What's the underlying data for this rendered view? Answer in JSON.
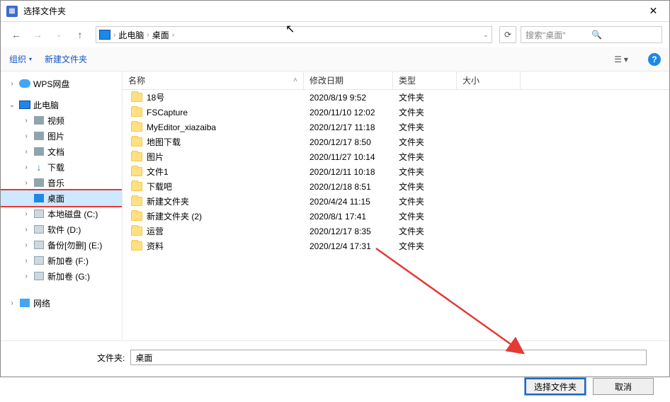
{
  "window": {
    "title": "选择文件夹"
  },
  "nav": {
    "crumbs": [
      "此电脑",
      "桌面"
    ],
    "search_placeholder": "搜索\"桌面\""
  },
  "toolbar": {
    "organize": "组织",
    "new_folder": "新建文件夹"
  },
  "columns": {
    "name": "名称",
    "date": "修改日期",
    "type": "类型",
    "size": "大小"
  },
  "sidebar": [
    {
      "label": "WPS网盘",
      "indent": 10,
      "exp": "›",
      "icon": "cloud"
    },
    {
      "label": "此电脑",
      "indent": 10,
      "exp": "⌄",
      "icon": "pc"
    },
    {
      "label": "视频",
      "indent": 30,
      "exp": "›",
      "icon": "generic"
    },
    {
      "label": "图片",
      "indent": 30,
      "exp": "›",
      "icon": "generic"
    },
    {
      "label": "文档",
      "indent": 30,
      "exp": "›",
      "icon": "generic"
    },
    {
      "label": "下载",
      "indent": 30,
      "exp": "›",
      "icon": "down"
    },
    {
      "label": "音乐",
      "indent": 30,
      "exp": "›",
      "icon": "generic"
    },
    {
      "label": "桌面",
      "indent": 30,
      "exp": "",
      "icon": "desk",
      "sel": true,
      "redbox": true
    },
    {
      "label": "本地磁盘 (C:)",
      "indent": 30,
      "exp": "›",
      "icon": "disk"
    },
    {
      "label": "软件 (D:)",
      "indent": 30,
      "exp": "›",
      "icon": "disk"
    },
    {
      "label": "备份[勿删] (E:)",
      "indent": 30,
      "exp": "›",
      "icon": "disk"
    },
    {
      "label": "新加卷 (F:)",
      "indent": 30,
      "exp": "›",
      "icon": "disk"
    },
    {
      "label": "新加卷 (G:)",
      "indent": 30,
      "exp": "›",
      "icon": "disk"
    },
    {
      "label": "网络",
      "indent": 10,
      "exp": "›",
      "icon": "net"
    }
  ],
  "files": [
    {
      "name": "18号",
      "date": "2020/8/19 9:52",
      "type": "文件夹"
    },
    {
      "name": "FSCapture",
      "date": "2020/11/10 12:02",
      "type": "文件夹"
    },
    {
      "name": "MyEditor_xiazaiba",
      "date": "2020/12/17 11:18",
      "type": "文件夹"
    },
    {
      "name": "地图下载",
      "date": "2020/12/17 8:50",
      "type": "文件夹"
    },
    {
      "name": "图片",
      "date": "2020/11/27 10:14",
      "type": "文件夹"
    },
    {
      "name": "文件1",
      "date": "2020/12/11 10:18",
      "type": "文件夹"
    },
    {
      "name": "下载吧",
      "date": "2020/12/18 8:51",
      "type": "文件夹"
    },
    {
      "name": "新建文件夹",
      "date": "2020/4/24 11:15",
      "type": "文件夹"
    },
    {
      "name": "新建文件夹 (2)",
      "date": "2020/8/1 17:41",
      "type": "文件夹"
    },
    {
      "name": "运营",
      "date": "2020/12/17 8:35",
      "type": "文件夹"
    },
    {
      "name": "资料",
      "date": "2020/12/4 17:31",
      "type": "文件夹"
    }
  ],
  "bottom": {
    "label": "文件夹:",
    "value": "桌面",
    "ok": "选择文件夹",
    "cancel": "取消"
  }
}
